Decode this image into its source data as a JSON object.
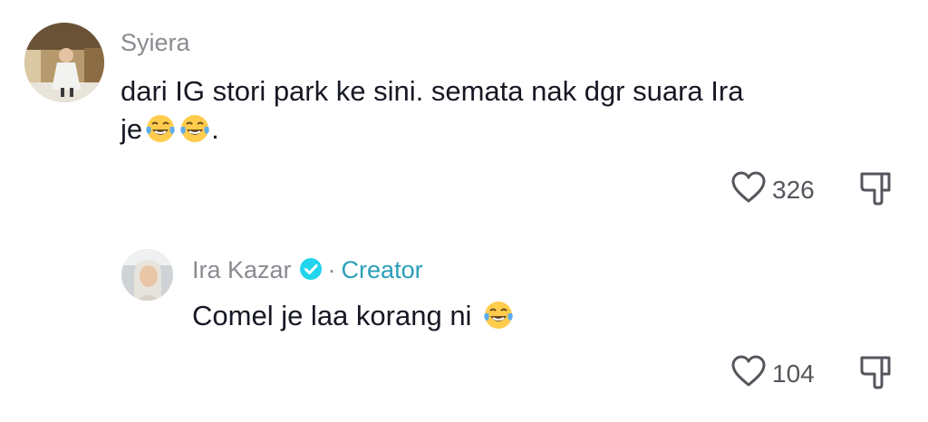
{
  "comments": [
    {
      "username": "Syiera",
      "text_line1": "dari IG stori park ke sini. semata nak dgr suara Ira",
      "text_line2": "je",
      "text_line2_suffix": ".",
      "emoji_name": "face-with-tears-of-joy",
      "likes": "326"
    },
    {
      "username": "Ira Kazar",
      "separator": "·",
      "badge": "Creator",
      "text": "Comel je laa korang ni",
      "emoji_name": "face-with-tears-of-joy",
      "likes": "104"
    }
  ],
  "colors": {
    "username": "#8a8b91",
    "text": "#161823",
    "creator": "#2a9fb8",
    "verified": "#20d5ec"
  }
}
